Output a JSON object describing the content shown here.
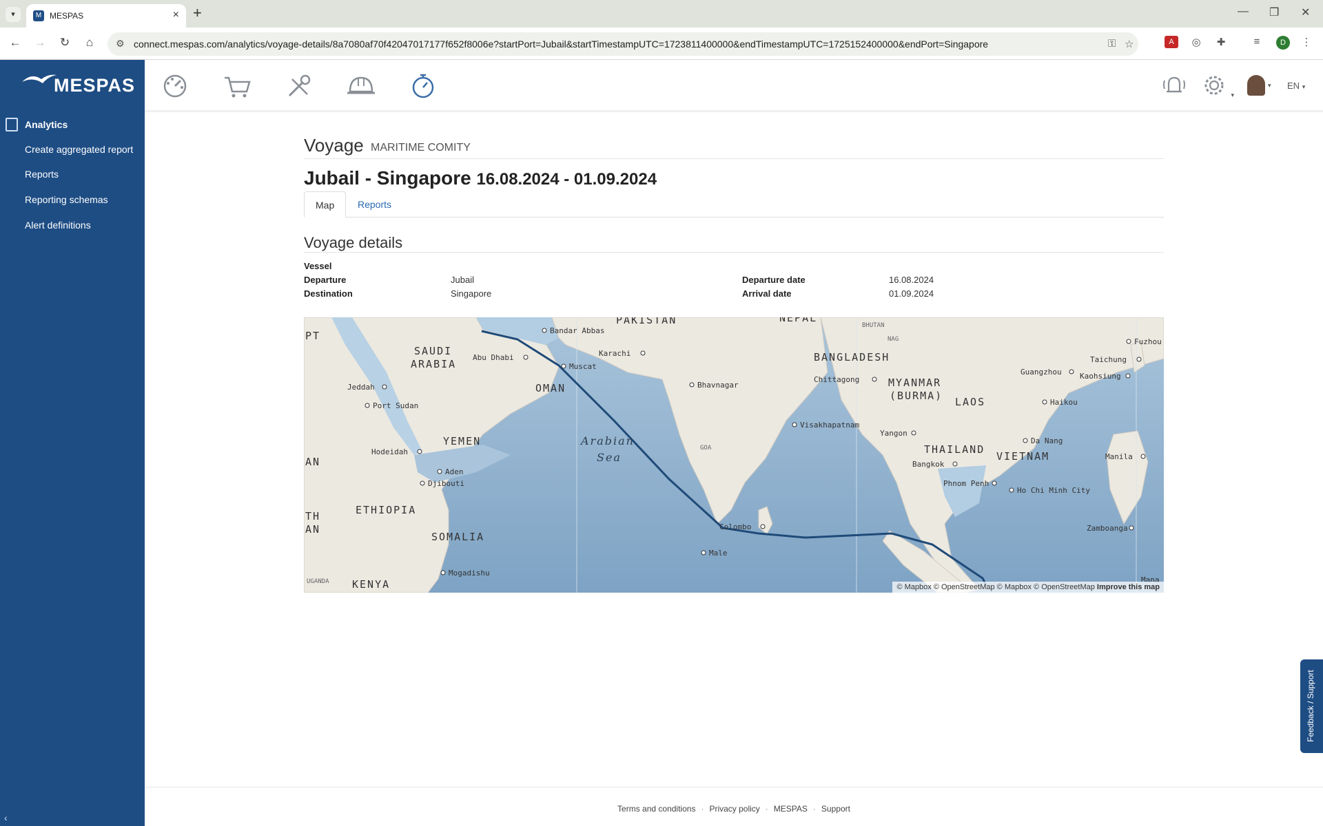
{
  "browser": {
    "tab_title": "MESPAS",
    "url": "connect.mespas.com/analytics/voyage-details/8a7080af70f42047017177f652f8006e?startPort=Jubail&startTimestampUTC=1723811400000&endTimestampUTC=1725152400000&endPort=Singapore",
    "profile_initial": "D"
  },
  "logo": {
    "text": "MESPAS"
  },
  "sidebar": {
    "section_label": "Analytics",
    "items": [
      {
        "label": "Create aggregated report"
      },
      {
        "label": "Reports"
      },
      {
        "label": "Reporting schemas"
      },
      {
        "label": "Alert definitions"
      }
    ]
  },
  "topnav": {
    "icons": [
      "dashboard-icon",
      "cart-icon",
      "tools-icon",
      "helmet-icon",
      "stopwatch-icon"
    ],
    "language": "EN"
  },
  "voyage": {
    "title": "Voyage",
    "vessel_name": "MARITIME COMITY",
    "route": "Jubail - Singapore",
    "dates": "16.08.2024 - 01.09.2024"
  },
  "tabs": [
    {
      "label": "Map",
      "active": true
    },
    {
      "label": "Reports",
      "active": false
    }
  ],
  "details": {
    "title": "Voyage details",
    "vessel_label": "Vessel",
    "vessel_value": "",
    "departure_label": "Departure",
    "departure_value": "Jubail",
    "destination_label": "Destination",
    "destination_value": "Singapore",
    "departure_date_label": "Departure date",
    "departure_date_value": "16.08.2024",
    "arrival_date_label": "Arrival date",
    "arrival_date_value": "01.09.2024"
  },
  "map": {
    "labels": {
      "pakistan": "PAKISTAN",
      "nepal": "NEPAL",
      "bhutan": "BHUTAN",
      "saudi1": "SAUDI",
      "saudi2": "ARABIA",
      "oman": "OMAN",
      "yemen": "YEMEN",
      "ethiopia": "ETHIOPIA",
      "somalia": "SOMALIA",
      "kenya": "KENYA",
      "bangladesh": "BANGLADESH",
      "myanmar1": "MYANMAR",
      "myanmar2": "(BURMA)",
      "laos": "LAOS",
      "thailand": "THAILAND",
      "vietnam": "VIETNAM",
      "arabian": "Arabian",
      "sea": "Sea",
      "pt": "PT",
      "an1": "AN",
      "th": "TH",
      "an2": "AN",
      "uganda": "UGANDA",
      "goa": "GOA",
      "nag": "NAG",
      "bandar_abbas": "Bandar Abbas",
      "karachi": "Karachi",
      "abu_dhabi": "Abu Dhabi",
      "muscat": "Muscat",
      "jeddah": "Jeddah",
      "port_sudan": "Port Sudan",
      "hodeidah": "Hodeidah",
      "aden": "Aden",
      "djibouti": "Djibouti",
      "mogadishu": "Mogadishu",
      "bhavnagar": "Bhavnagar",
      "colombo": "Colombo",
      "male": "Male",
      "visakhapatnam": "Visakhapatnam",
      "chittagong": "Chittagong",
      "yangon": "Yangon",
      "bangkok": "Bangkok",
      "phnom_penh": "Phnom Penh",
      "ho_chi_minh": "Ho Chi Minh City",
      "da_nang": "Da Nang",
      "haikou": "Haikou",
      "guangzhou": "Guangzhou",
      "kaohsiung": "Kaohsiung",
      "taichung": "Taichung",
      "fuzhou": "Fuzhou",
      "manila": "Manila",
      "zamboanga": "Zamboanga",
      "manado": "Mana"
    },
    "route_color": "#1f4a78",
    "attribution": "© Mapbox © OpenStreetMap © Mapbox © OpenStreetMap",
    "improve": "Improve this map"
  },
  "feedback": {
    "label": "Feedback / Support"
  },
  "footer": {
    "links": [
      "Terms and conditions",
      "Privacy policy",
      "MESPAS",
      "Support"
    ]
  }
}
